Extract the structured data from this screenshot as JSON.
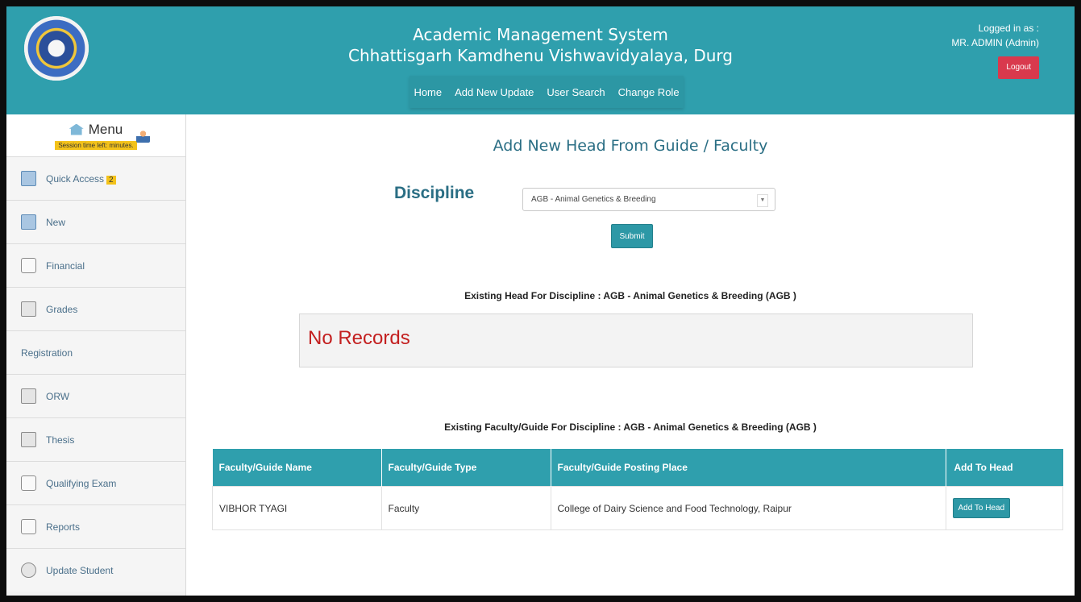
{
  "header": {
    "title_line1": "Academic Management System",
    "title_line2": "Chhattisgarh Kamdhenu Vishwavidyalaya, Durg",
    "nav": [
      "Home",
      "Add New Update",
      "User Search",
      "Change Role"
    ],
    "logged_in_label": "Logged in as :",
    "user_name": "MR. ADMIN (Admin)",
    "logout_label": "Logout"
  },
  "sidebar": {
    "menu_label": "Menu",
    "session_text": "Session time left: minutes.",
    "items": [
      {
        "label": "Quick Access",
        "badge": "2",
        "icon": "quick-access-icon"
      },
      {
        "label": "New",
        "icon": "new-icon"
      },
      {
        "label": "Financial",
        "icon": "lock-icon"
      },
      {
        "label": "Grades",
        "icon": "grid-icon"
      },
      {
        "label": "Registration",
        "icon": "user-icon"
      },
      {
        "label": "ORW",
        "icon": "grid-icon"
      },
      {
        "label": "Thesis",
        "icon": "grid-icon"
      },
      {
        "label": "Qualifying Exam",
        "icon": "exam-icon"
      },
      {
        "label": "Reports",
        "icon": "report-icon"
      },
      {
        "label": "Update Student",
        "icon": "update-icon"
      }
    ]
  },
  "main": {
    "page_title": "Add New Head From Guide / Faculty",
    "discipline_label": "Discipline",
    "discipline_value": "AGB - Animal Genetics & Breeding",
    "submit_label": "Submit",
    "head_caption": "Existing Head For Discipline : AGB - Animal Genetics & Breeding (AGB )",
    "no_records": "No Records",
    "faculty_caption": "Existing Faculty/Guide For Discipline : AGB - Animal Genetics & Breeding (AGB )",
    "table": {
      "headers": [
        "Faculty/Guide Name",
        "Faculty/Guide Type",
        "Faculty/Guide Posting Place",
        "Add To Head"
      ],
      "rows": [
        {
          "name": "VIBHOR TYAGI",
          "type": "Faculty",
          "place": "College of Dairy Science and Food Technology, Raipur",
          "action": "Add To Head"
        }
      ]
    }
  },
  "colors": {
    "accent": "#2f9fad",
    "error": "#c31f1f",
    "badge": "#f3c21a",
    "logout": "#d9394d"
  }
}
